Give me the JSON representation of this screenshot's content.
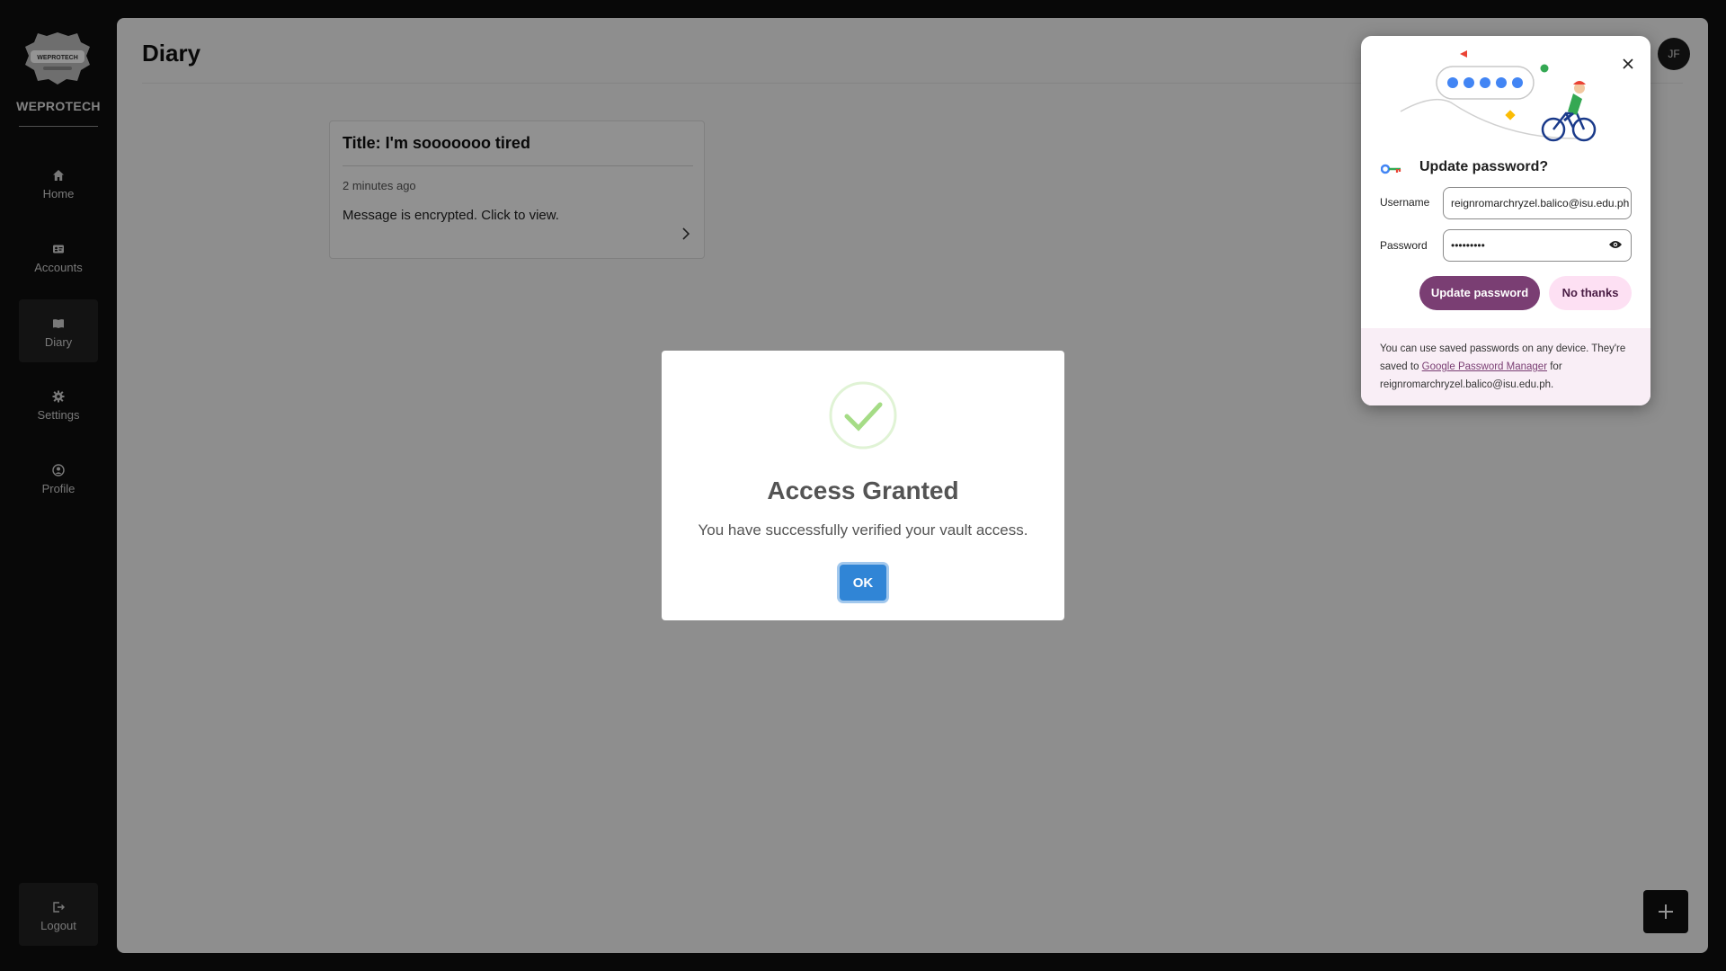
{
  "sidebar": {
    "brand": "WEPROTECH",
    "logo_text": "WEPROTECH",
    "items": [
      {
        "label": "Home",
        "icon": "home-icon"
      },
      {
        "label": "Accounts",
        "icon": "id-card-icon"
      },
      {
        "label": "Diary",
        "icon": "book-icon",
        "active": true
      },
      {
        "label": "Settings",
        "icon": "gear-icon"
      },
      {
        "label": "Profile",
        "icon": "user-circle-icon"
      }
    ],
    "logout": {
      "label": "Logout",
      "icon": "logout-icon"
    }
  },
  "header": {
    "title": "Diary",
    "avatar_initials": "JF"
  },
  "diary_entries": [
    {
      "title": "Title: I'm sooooooo tired",
      "time": "2 minutes ago",
      "message": "Message is encrypted. Click to view."
    }
  ],
  "fab": {
    "icon": "plus-icon"
  },
  "modal": {
    "title": "Access Granted",
    "text": "You have successfully verified your vault access.",
    "ok_label": "OK",
    "icon": "success-check-icon"
  },
  "password_prompt": {
    "heading": "Update password?",
    "username_label": "Username",
    "username_value": "reignromarchryzel.balico@isu.edu.ph",
    "password_label": "Password",
    "password_value": "•••••••••",
    "update_label": "Update password",
    "no_thanks_label": "No thanks",
    "footer_before": "You can use saved passwords on any device. They're saved to ",
    "footer_link": "Google Password Manager",
    "footer_after": " for reignromarchryzel.balico@isu.edu.ph."
  },
  "colors": {
    "accent_blue": "#3085d6",
    "success_green": "#a5dc86",
    "pw_primary": "#7a3e73",
    "pw_secondary": "#fde0f3"
  }
}
